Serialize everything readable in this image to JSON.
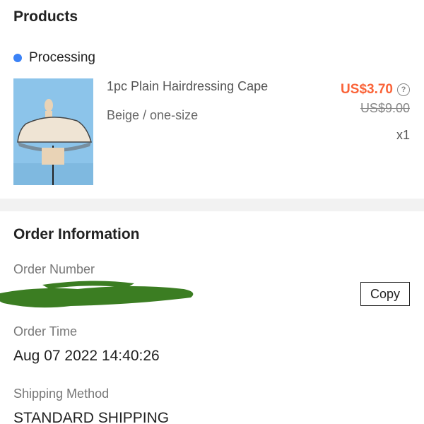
{
  "products": {
    "title": "Products",
    "status": "Processing",
    "status_color": "#3b82f6",
    "item": {
      "name": "1pc Plain Hairdressing Cape",
      "variant": "Beige / one-size",
      "price": "US$3.70",
      "original_price": "US$9.00",
      "quantity": "x1",
      "price_color": "#fa6338",
      "help_icon": "question-circle-icon"
    }
  },
  "order_info": {
    "title": "Order Information",
    "order_number_label": "Order Number",
    "copy_label": "Copy",
    "order_time_label": "Order Time",
    "order_time": "Aug 07 2022 14:40:26",
    "shipping_method_label": "Shipping Method",
    "shipping_method": "STANDARD SHIPPING"
  }
}
